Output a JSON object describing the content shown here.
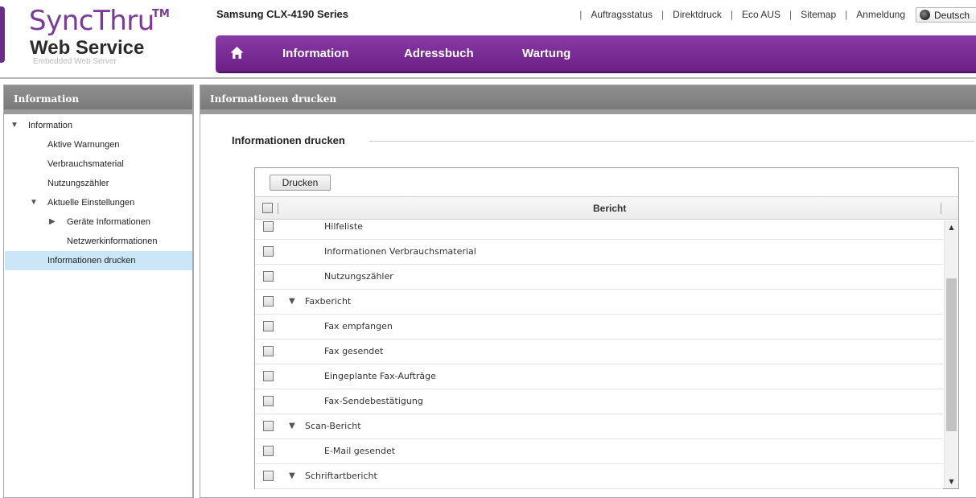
{
  "branding": {
    "title": "SyncThru",
    "trademark": "TM",
    "subtitle": "Web Service",
    "tagline": "Embedded Web Server"
  },
  "device": {
    "model": "Samsung CLX-4190 Series"
  },
  "toplinks": {
    "items": [
      {
        "label": "Auftragsstatus"
      },
      {
        "label": "Direktdruck"
      },
      {
        "label": "Eco AUS"
      },
      {
        "label": "Sitemap"
      },
      {
        "label": "Anmeldung"
      }
    ],
    "language": "Deutsch",
    "language_icon": "globe-icon"
  },
  "nav": {
    "home_icon": "home-icon",
    "items": [
      {
        "label": "Information"
      },
      {
        "label": "Adressbuch"
      },
      {
        "label": "Wartung"
      }
    ],
    "colors": {
      "bar": "#7a2c96"
    }
  },
  "sidebar": {
    "header": "Information",
    "items": [
      {
        "label": "Information",
        "expanded": true
      },
      {
        "label": "Aktive Warnungen"
      },
      {
        "label": "Verbrauchsmaterial"
      },
      {
        "label": "Nutzungszähler"
      },
      {
        "label": "Aktuelle Einstellungen",
        "expanded": true
      },
      {
        "label": "Geräte Informationen",
        "expanded": false
      },
      {
        "label": "Netzwerkinformationen"
      },
      {
        "label": "Informationen drucken",
        "selected": true
      }
    ]
  },
  "main": {
    "header": "Informationen drucken",
    "section_title": "Informationen drucken",
    "print_button": "Drucken",
    "column_header": "Bericht",
    "rows": [
      {
        "label": "Hilfeliste",
        "level": 2,
        "group": false,
        "checked": false
      },
      {
        "label": "Informationen Verbrauchsmaterial",
        "level": 2,
        "group": false,
        "checked": false
      },
      {
        "label": "Nutzungszähler",
        "level": 2,
        "group": false,
        "checked": false
      },
      {
        "label": "Faxbericht",
        "level": 1,
        "group": true,
        "checked": false
      },
      {
        "label": "Fax empfangen",
        "level": 2,
        "group": false,
        "checked": false
      },
      {
        "label": "Fax gesendet",
        "level": 2,
        "group": false,
        "checked": false
      },
      {
        "label": "Eingeplante Fax-Aufträge",
        "level": 2,
        "group": false,
        "checked": false
      },
      {
        "label": "Fax-Sendebestätigung",
        "level": 2,
        "group": false,
        "checked": false
      },
      {
        "label": "Scan-Bericht",
        "level": 1,
        "group": true,
        "checked": false
      },
      {
        "label": "E-Mail gesendet",
        "level": 2,
        "group": false,
        "checked": false
      },
      {
        "label": "Schriftartbericht",
        "level": 1,
        "group": true,
        "checked": false
      }
    ],
    "select_all_checked": false
  }
}
